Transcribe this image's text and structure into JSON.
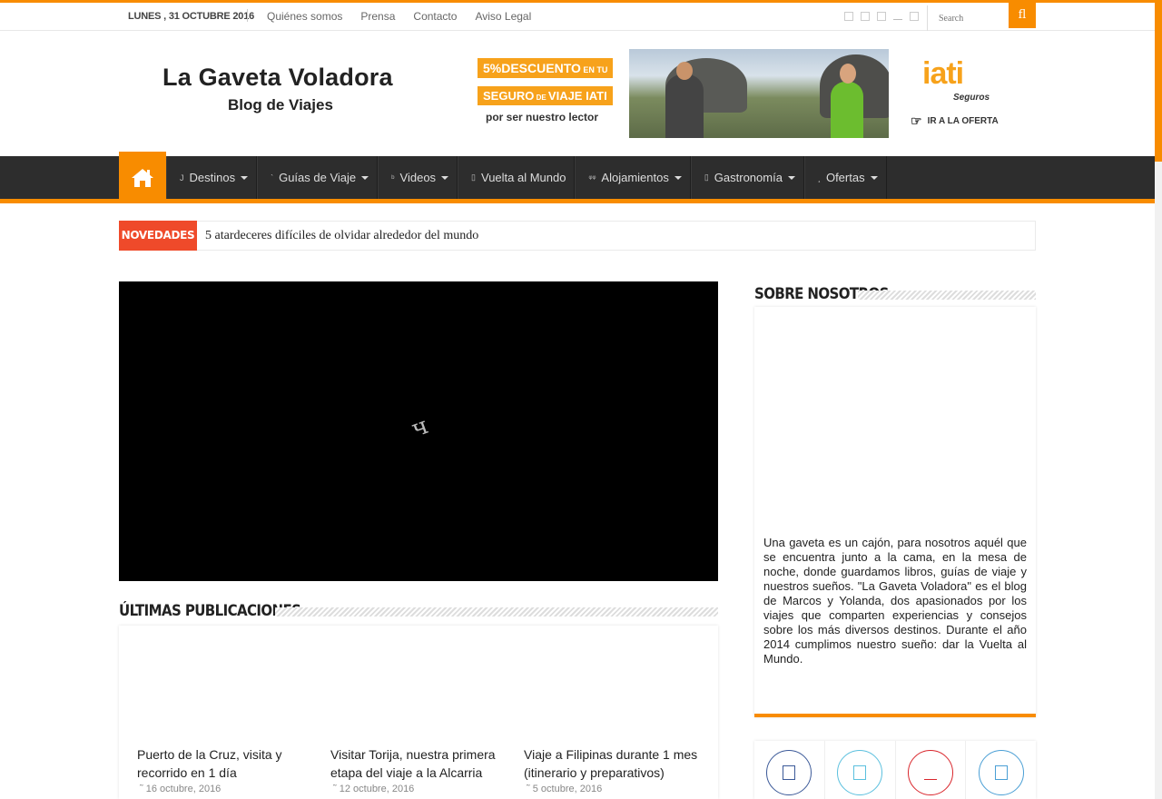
{
  "topbar": {
    "date": "LUNES , 31 OCTUBRE 2016",
    "links": [
      "Quiénes somos",
      "Prensa",
      "Contacto",
      "Aviso Legal"
    ],
    "search_placeholder": "Search",
    "search_icon": "search-icon"
  },
  "header": {
    "site_title": "La Gaveta Voladora",
    "site_subtitle": "Blog de Viajes"
  },
  "banner": {
    "line1_big": "5%DESCUENTO",
    "line1_small": " EN TU",
    "line2_a": "SEGURO",
    "line2_small": " DE ",
    "line2_b": "VIAJE IATI",
    "line3": "por ser nuestro lector",
    "brand": "iati",
    "brand_sub": "Seguros",
    "cta": "IR A LA OFERTA"
  },
  "nav": {
    "home_icon": "home-icon",
    "items": [
      {
        "icon": "J",
        "label": "Destinos",
        "dropdown": true
      },
      {
        "icon": "`",
        "label": "Guías de Viaje",
        "dropdown": true
      },
      {
        "icon": "ᵇ",
        "label": "Videos",
        "dropdown": true
      },
      {
        "icon": "▯",
        "label": "Vuelta al Mundo",
        "dropdown": false
      },
      {
        "icon": "ᵠᵠ",
        "label": "Alojamientos",
        "dropdown": true
      },
      {
        "icon": "▯",
        "label": "Gastronomía",
        "dropdown": true
      },
      {
        "icon": "¸",
        "label": "Ofertas",
        "dropdown": true
      }
    ]
  },
  "ticker": {
    "label": "NOVEDADES",
    "headline": "5 atardeceres difíciles de olvidar alrededor del mundo"
  },
  "video": {
    "spinner_glyph": "ч"
  },
  "latest": {
    "title": "ÚLTIMAS PUBLICACIONES",
    "posts": [
      {
        "title": "Puerto de la Cruz, visita y recorrido en 1 día",
        "date": "16 octubre, 2016"
      },
      {
        "title": "Visitar Torija, nuestra primera etapa del viaje a la Alcarria",
        "date": "12 octubre, 2016"
      },
      {
        "title": "Viaje a Filipinas durante 1 mes (itinerario y preparativos)",
        "date": "5 octubre, 2016"
      }
    ]
  },
  "sidebar": {
    "about_title": "SOBRE NOSOTROS",
    "about_text": "Una gaveta es un cajón, para nosotros aquél que se encuentra junto a la cama, en la mesa de noche, donde guardamos libros, guías de viaje y nuestros sueños. \"La Gaveta Voladora\" es el blog de Marcos y Yolanda, dos apasionados por los viajes que comparten experiencias y consejos sobre los más diversos destinos. Durante el año 2014 cumplimos nuestro sueño: dar la Vuelta al Mundo.",
    "social": [
      {
        "name": "facebook-icon",
        "color": "#3b5998"
      },
      {
        "name": "twitter-icon",
        "color": "#5bc0de"
      },
      {
        "name": "youtube-icon",
        "color": "#d9262c"
      },
      {
        "name": "googleplus-icon",
        "color": "#4a9fd5"
      }
    ]
  },
  "colors": {
    "accent": "#f88c00",
    "ticker_label": "#ef4a2a",
    "nav_bg": "#2d2d2d"
  }
}
